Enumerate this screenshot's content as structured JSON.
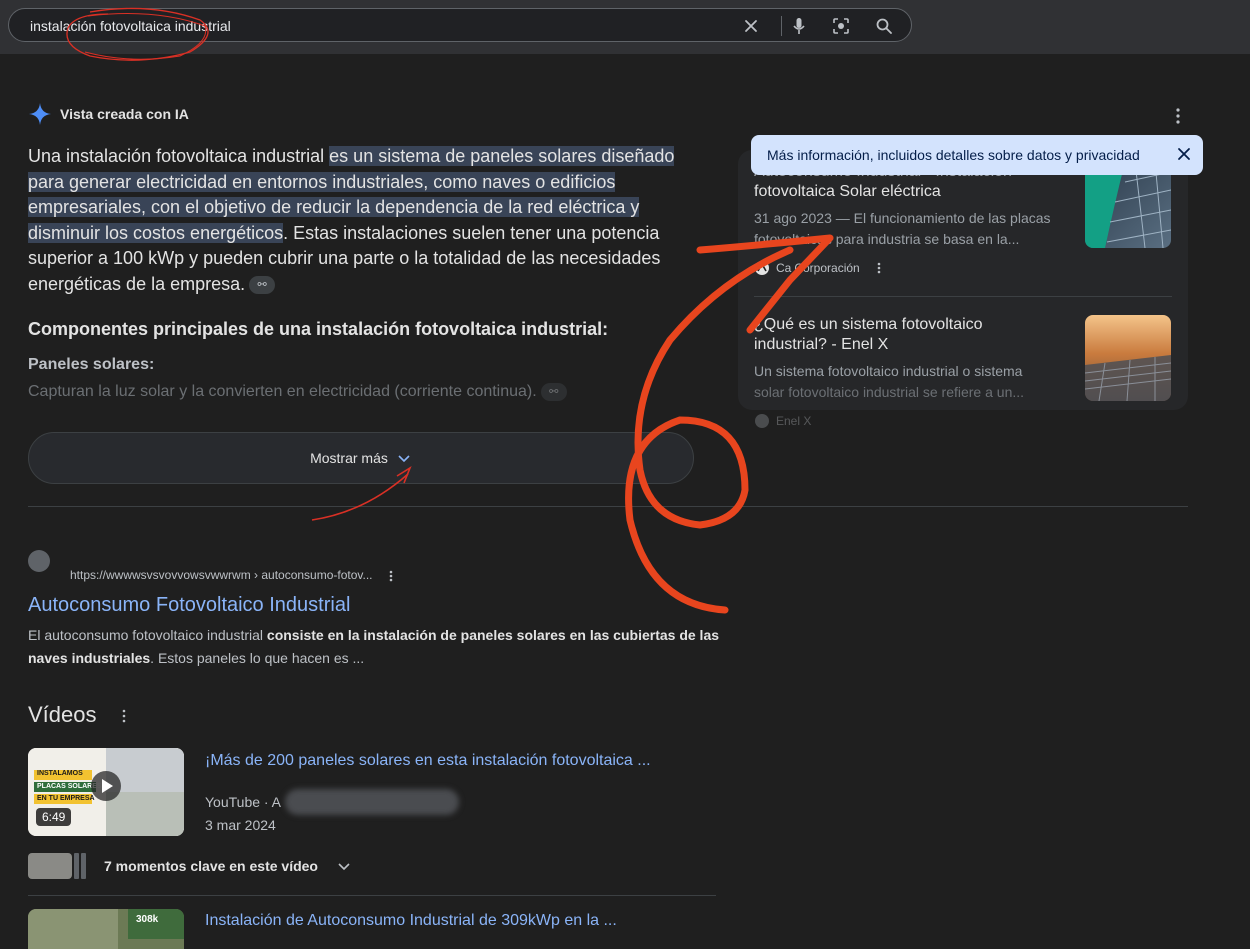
{
  "search": {
    "query": "instalación fotovoltaica industrial"
  },
  "ai_overview": {
    "header": "Vista creada con IA",
    "para_start": "Una instalación fotovoltaica industrial ",
    "para_highlight": "es un sistema de paneles solares diseñado para generar electricidad en entornos industriales, como naves o edificios empresariales, con el objetivo de reducir la dependencia de la red eléctrica y disminuir los costos energéticos",
    "para_rest": ". Estas instalaciones suelen tener una potencia superior a 100 kWp y pueden cubrir una parte o la totalidad de las necesidades energéticas de la empresa.",
    "heading": "Componentes principales de una instalación fotovoltaica industrial:",
    "sub_heading": "Paneles solares:",
    "faded_text": "Capturan la luz solar y la convierten en electricidad (corriente continua).",
    "show_more": "Mostrar más"
  },
  "tooltip": {
    "text": "Más información, incluidos detalles sobre datos y privacidad"
  },
  "side_cards": [
    {
      "title_line1": "Autoconsumo Industrial - Instalación",
      "title_line2": "fotovoltaica Solar eléctrica",
      "snippet_line1": "31 ago 2023 — El funcionamiento de las placas",
      "snippet_line2": "fotovoltaicas para industria se basa en la...",
      "source": "Corporación",
      "source_prefix": "Ca"
    },
    {
      "title_line1": "¿Qué es un sistema fotovoltaico",
      "title_line2": "industrial? - Enel X",
      "snippet_line1": "Un sistema fotovoltaico industrial o sistema",
      "snippet_line2": "solar fotovoltaico industrial se refiere a un...",
      "source": "Enel X"
    }
  ],
  "result": {
    "url": "https://wwwwsvsvovvowsvwwrwm › autoconsumo-fotov...",
    "title": "Autoconsumo Fotovoltaico Industrial",
    "snippet_a": "El autoconsumo fotovoltaico industrial ",
    "snippet_bold": "consiste en la instalación de paneles solares en las cubiertas de las naves industriales",
    "snippet_b": ". Estos paneles lo que hacen es ..."
  },
  "videos": {
    "section_title": "Vídeos",
    "items": [
      {
        "title": "¡Más de 200 paneles solares en esta instalación fotovoltaica ...",
        "source": "YouTube · A",
        "date": "3 mar 2024",
        "duration": "6:49",
        "thumb_text_1": "INSTALAMOS",
        "thumb_text_2": "PLACAS SOLARES",
        "thumb_text_3": "EN TU EMPRESA"
      },
      {
        "title": "Instalación de Autoconsumo Industrial de 309kWp en la ...",
        "thumb_text": "308k"
      }
    ],
    "moments": "7 momentos clave en este vídeo"
  },
  "colors": {
    "background": "#1f1f1f",
    "link": "#8ab4f8",
    "highlight": "#394457",
    "tooltip_bg": "#d3e3fd",
    "annotation": "#e8451e"
  }
}
